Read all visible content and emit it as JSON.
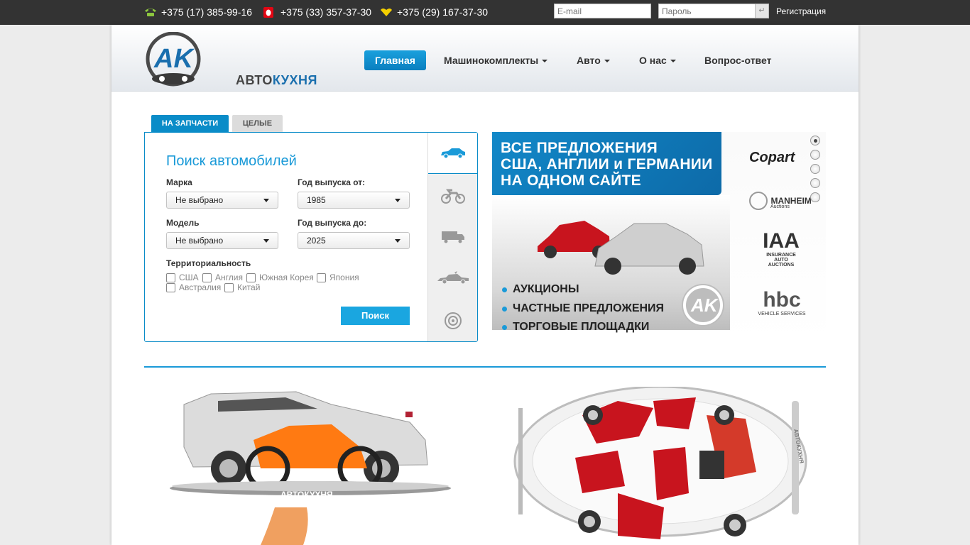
{
  "topbar": {
    "phones": [
      {
        "icon": "landline-phone-icon",
        "number": "+375 (17) 385-99-16",
        "color": "#8dc63f"
      },
      {
        "icon": "mts-operator-icon",
        "number": "+375 (33) 357-37-30",
        "color": "#e30613"
      },
      {
        "icon": "velcom-operator-icon",
        "number": "+375 (29) 167-37-30",
        "color": "#f5d000"
      }
    ],
    "email_placeholder": "E-mail",
    "password_placeholder": "Пароль",
    "enter_glyph": "↵",
    "register_label": "Регистрация"
  },
  "logo": {
    "initials": "AK",
    "word_part1": "АВТО",
    "word_part2": "КУХНЯ"
  },
  "nav": [
    {
      "label": "Главная",
      "active": true,
      "dropdown": false
    },
    {
      "label": "Машинокомплекты",
      "active": false,
      "dropdown": true
    },
    {
      "label": "Авто",
      "active": false,
      "dropdown": true
    },
    {
      "label": "О нас",
      "active": false,
      "dropdown": true
    },
    {
      "label": "Вопрос-ответ",
      "active": false,
      "dropdown": false
    }
  ],
  "search": {
    "tabs": [
      "НА ЗАПЧАСТИ",
      "ЦЕЛЫЕ"
    ],
    "title": "Поиск автомобилей",
    "make_label": "Марка",
    "make_value": "Не выбрано",
    "year_from_label": "Год выпуска от:",
    "year_from_value": "1985",
    "model_label": "Модель",
    "model_value": "Не выбрано",
    "year_to_label": "Год выпуска до:",
    "year_to_value": "2025",
    "territory_label": "Территориальность",
    "countries": [
      "США",
      "Англия",
      "Южная Корея",
      "Япония",
      "Австралия",
      "Китай"
    ],
    "button": "Поиск",
    "vehicle_types": [
      "car-icon",
      "motorcycle-icon",
      "truck-icon",
      "wrecked-car-icon",
      "wheel-icon"
    ]
  },
  "banner": {
    "headline": [
      "ВСЕ ПРЕДЛОЖЕНИЯ",
      "США, АНГЛИИ и ГЕРМАНИИ",
      "НА ОДНОМ САЙТЕ"
    ],
    "bullets": [
      "АУКЦИОНЫ",
      "ЧАСТНЫЕ ПРЕДЛОЖЕНИЯ",
      "ТОРГОВЫЕ ПЛОЩАДКИ"
    ],
    "logo_initials": "AK",
    "brands": {
      "copart": "Copart",
      "manheim": "MANHEIM",
      "manheim_sub": "Auctions",
      "iaa": "IAA",
      "iaa_sub1": "INSURANCE",
      "iaa_sub2": "AUTO AUCTIONS",
      "hbc": "hbc",
      "hbc_sub": "VEHICLE SERVICES"
    }
  },
  "promo": {
    "tray_label": "АВТОКУХНЯ",
    "plate_label": "АВТОКУХНЯ"
  }
}
